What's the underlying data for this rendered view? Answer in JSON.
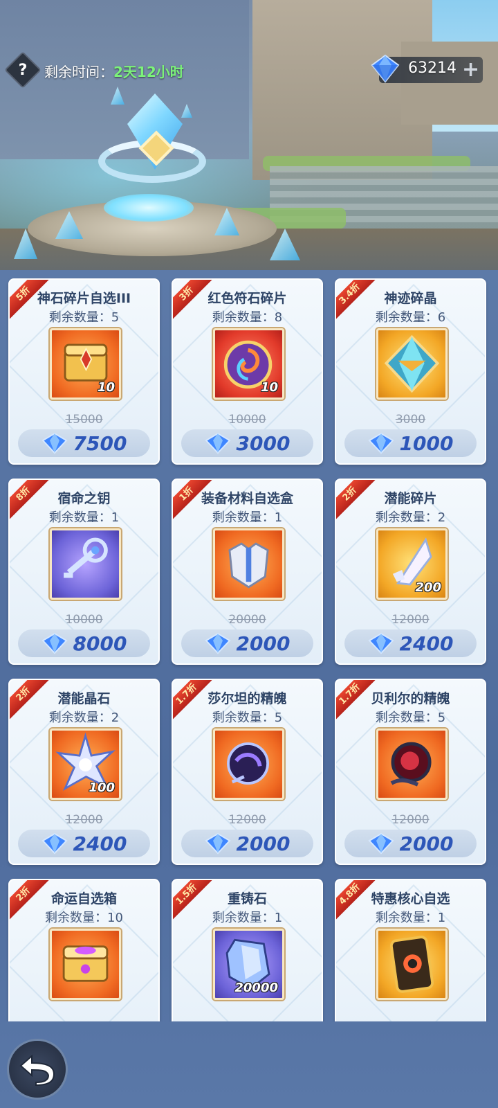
{
  "header": {
    "help_icon": "question-icon",
    "time_label": "剩余时间：",
    "time_value": "2天12小时",
    "gem_balance": "63214",
    "gem_icon": "diamond-icon",
    "plus_icon": "plus-icon"
  },
  "colors": {
    "time_value": "#7cf27a",
    "price_text": "#2d56b8",
    "ribbon": "#d5301f"
  },
  "stock_label": "剩余数量：",
  "items": [
    {
      "discount": "5折",
      "name": "神石碎片自选III",
      "stock": "5",
      "count": "10",
      "orig_price": "15000",
      "price": "7500",
      "icon": "golden-chest-icon",
      "bg": "orange"
    },
    {
      "discount": "3折",
      "name": "红色符石碎片",
      "stock": "8",
      "count": "10",
      "orig_price": "10000",
      "price": "3000",
      "icon": "swirl-rune-icon",
      "bg": "red"
    },
    {
      "discount": "3.4折",
      "name": "神迹碎晶",
      "stock": "6",
      "count": "",
      "orig_price": "3000",
      "price": "1000",
      "icon": "crystal-prism-icon",
      "bg": "gold"
    },
    {
      "discount": "8折",
      "name": "宿命之钥",
      "stock": "1",
      "count": "",
      "orig_price": "10000",
      "price": "8000",
      "icon": "fate-key-icon",
      "bg": "purple"
    },
    {
      "discount": "1折",
      "name": "装备材料自选盒",
      "stock": "1",
      "count": "",
      "orig_price": "20000",
      "price": "2000",
      "icon": "armor-icon",
      "bg": "orange"
    },
    {
      "discount": "2折",
      "name": "潜能碎片",
      "stock": "2",
      "count": "200",
      "orig_price": "12000",
      "price": "2400",
      "icon": "potential-shard-icon",
      "bg": "gold"
    },
    {
      "discount": "2折",
      "name": "潜能晶石",
      "stock": "2",
      "count": "100",
      "orig_price": "12000",
      "price": "2400",
      "icon": "star-crystal-icon",
      "bg": "orange"
    },
    {
      "discount": "1.7折",
      "name": "莎尔坦的精魄",
      "stock": "5",
      "count": "",
      "orig_price": "12000",
      "price": "2000",
      "icon": "dark-orb-icon",
      "bg": "orange"
    },
    {
      "discount": "1.7折",
      "name": "贝利尔的精魄",
      "stock": "5",
      "count": "",
      "orig_price": "12000",
      "price": "2000",
      "icon": "red-orb-icon",
      "bg": "orange"
    },
    {
      "discount": "2折",
      "name": "命运自选箱",
      "stock": "10",
      "count": "",
      "orig_price": "",
      "price": "",
      "icon": "fate-chest-icon",
      "bg": "orange"
    },
    {
      "discount": "1.5折",
      "name": "重铸石",
      "stock": "1",
      "count": "20000",
      "orig_price": "",
      "price": "",
      "icon": "reforge-stone-icon",
      "bg": "purple"
    },
    {
      "discount": "4.8折",
      "name": "特惠核心自选",
      "stock": "1",
      "count": "",
      "orig_price": "",
      "price": "",
      "icon": "core-card-icon",
      "bg": "gold"
    }
  ],
  "back_icon": "back-arrow-icon"
}
